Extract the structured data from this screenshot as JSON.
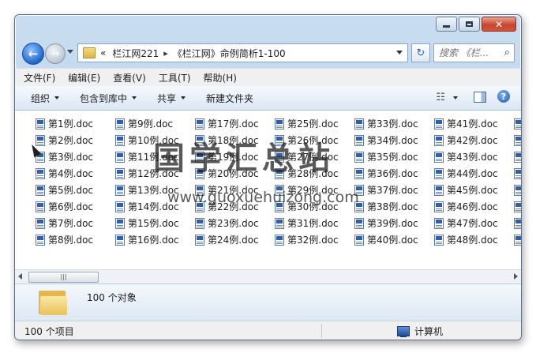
{
  "breadcrumb": {
    "root_glyph": "«",
    "parts": [
      "栏江网221",
      "《栏江网》命例简析1-100"
    ]
  },
  "search": {
    "placeholder": "搜索 《栏..."
  },
  "menu": [
    "文件(F)",
    "编辑(E)",
    "查看(V)",
    "工具(T)",
    "帮助(H)"
  ],
  "commands": {
    "organize": "组织",
    "include_library": "包含到库中",
    "share": "共享",
    "new_folder": "新建文件夹"
  },
  "files": [
    "第1例.doc",
    "第2例.doc",
    "第3例.doc",
    "第4例.doc",
    "第5例.doc",
    "第6例.doc",
    "第7例.doc",
    "第8例.doc",
    "第9例.doc",
    "第10例.doc",
    "第11例.doc",
    "第12例.doc",
    "第13例.doc",
    "第14例.doc",
    "第15例.doc",
    "第16例.doc",
    "第17例.doc",
    "第18例.doc",
    "第19例.doc",
    "第20例.doc",
    "第21例.doc",
    "第22例.doc",
    "第23例.doc",
    "第24例.doc",
    "第25例.doc",
    "第26例.doc",
    "第27例.doc",
    "第28例.doc",
    "第29例.doc",
    "第30例.doc",
    "第31例.doc",
    "第32例.doc",
    "第33例.doc",
    "第34例.doc",
    "第35例.doc",
    "第36例.doc",
    "第37例.doc",
    "第38例.doc",
    "第39例.doc",
    "第40例.doc",
    "第41例.doc",
    "第42例.doc",
    "第43例.doc",
    "第44例.doc",
    "第45例.doc",
    "第46例.doc",
    "第47例.doc",
    "第48例.doc",
    "",
    "",
    "",
    "",
    "",
    "",
    "",
    ""
  ],
  "watermark": {
    "text": "国学汇总站",
    "url": "www.guoxuehuizong.com"
  },
  "details": {
    "count": "100 个对象"
  },
  "status": {
    "items": "100 个项目",
    "location": "计算机"
  }
}
